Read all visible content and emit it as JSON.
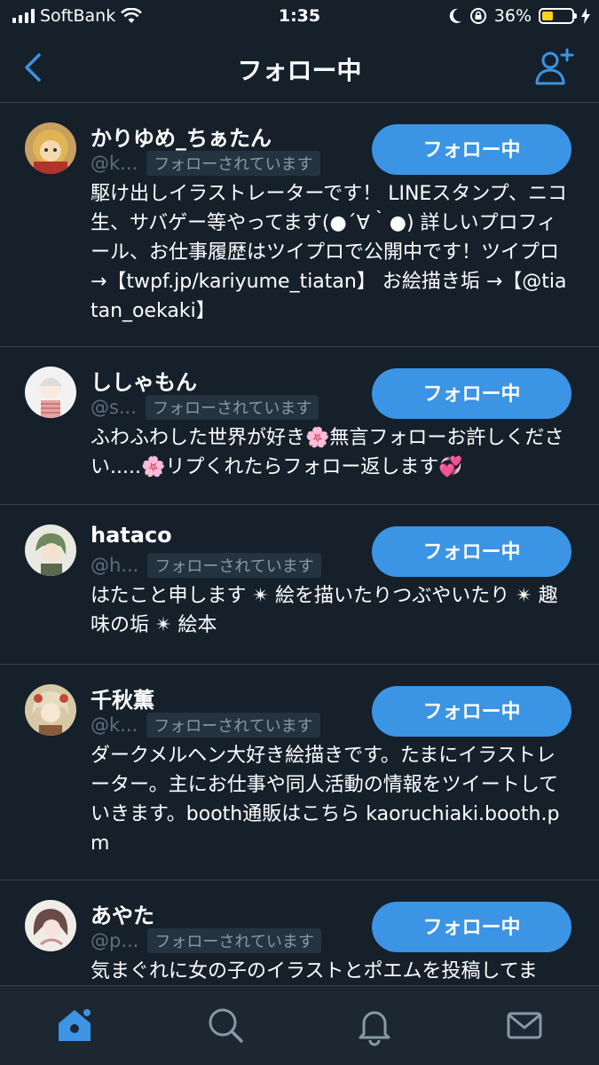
{
  "status_bar": {
    "carrier": "SoftBank",
    "time": "1:35",
    "battery_percent": "36%",
    "battery_level": 0.36
  },
  "nav": {
    "title": "フォロー中"
  },
  "users": [
    {
      "name": "かりゆめ_ちぁたん",
      "handle": "@k...",
      "follows_you": "フォローされています",
      "button": "フォロー中",
      "bio": "駆け出しイラストレーターです！ LINEスタンプ、ニコ生、サバゲー等やってます(●´∀｀●) 詳しいプロフィール、お仕事履歴はツイプロで公開中です！ツイプロ→【twpf.jp/kariyume_tiatan】 お絵描き垢 →【@tiatan_oekaki】"
    },
    {
      "name": "ししゃもん",
      "handle": "@s...",
      "follows_you": "フォローされています",
      "button": "フォロー中",
      "bio": "ふわふわした世界が好き🌸無言フォローお許しください.....🌸リプくれたらフォロー返します💞"
    },
    {
      "name": "hataco",
      "handle": "@h...",
      "follows_you": "フォローされています",
      "button": "フォロー中",
      "bio": "はたこと申します ✴ 絵を描いたりつぶやいたり ✴ 趣味の垢 ✴ 絵本"
    },
    {
      "name": "千秋薫",
      "handle": "@k...",
      "follows_you": "フォローされています",
      "button": "フォロー中",
      "bio": "ダークメルヘン大好き絵描きです。たまにイラストレーター。主にお仕事や同人活動の情報をツイートしていきます。booth通販はこちら kaoruchiaki.booth.pm"
    },
    {
      "name": "あやた",
      "handle": "@p...",
      "follows_you": "フォローされています",
      "button": "フォロー中",
      "bio": "気まぐれに女の子のイラストとポエムを投稿してま"
    }
  ],
  "colors": {
    "background": "#15202b",
    "accent": "#3b94e4",
    "tab_bar": "#1c2732",
    "divider": "#38444d"
  }
}
